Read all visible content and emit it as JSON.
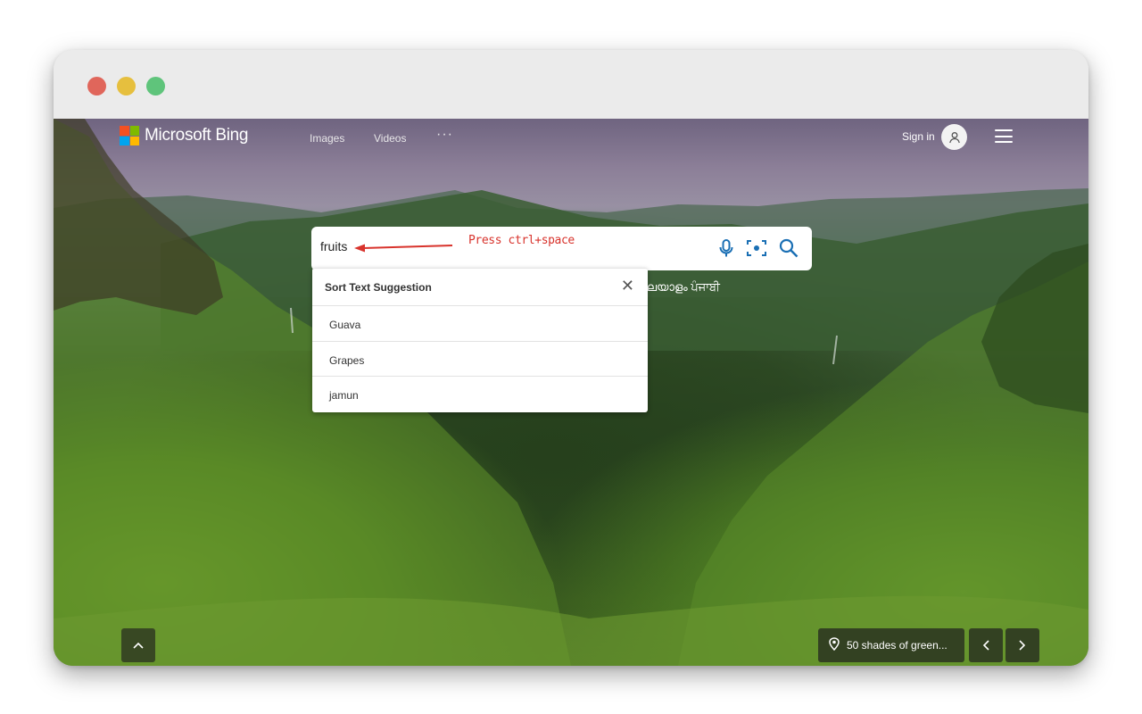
{
  "window": {
    "controls": [
      "close",
      "minimize",
      "maximize"
    ]
  },
  "header": {
    "brand": "Microsoft Bing",
    "nav": {
      "images": "Images",
      "videos": "Videos",
      "more": "···"
    },
    "signin_label": "Sign in",
    "avatar_icon": "user-icon",
    "menu_icon": "hamburger-icon"
  },
  "search": {
    "value": "fruits",
    "annotation": "Press ctrl+space",
    "annotation_color": "#d8332c",
    "icons": [
      "microphone-icon",
      "visual-search-icon",
      "search-icon"
    ]
  },
  "languages": "ലയാളം ਪੰਜਾਬੀ",
  "suggestions": {
    "title": "Sort Text Suggestion",
    "close_label": "✕",
    "items": [
      "Guava",
      "Grapes",
      "jamun"
    ]
  },
  "footer": {
    "caption": "50 shades of green...",
    "caption_icon": "location-pin-icon",
    "scroll_icon": "chevron-up-icon",
    "prev_icon": "chevron-left-icon",
    "next_icon": "chevron-right-icon"
  }
}
